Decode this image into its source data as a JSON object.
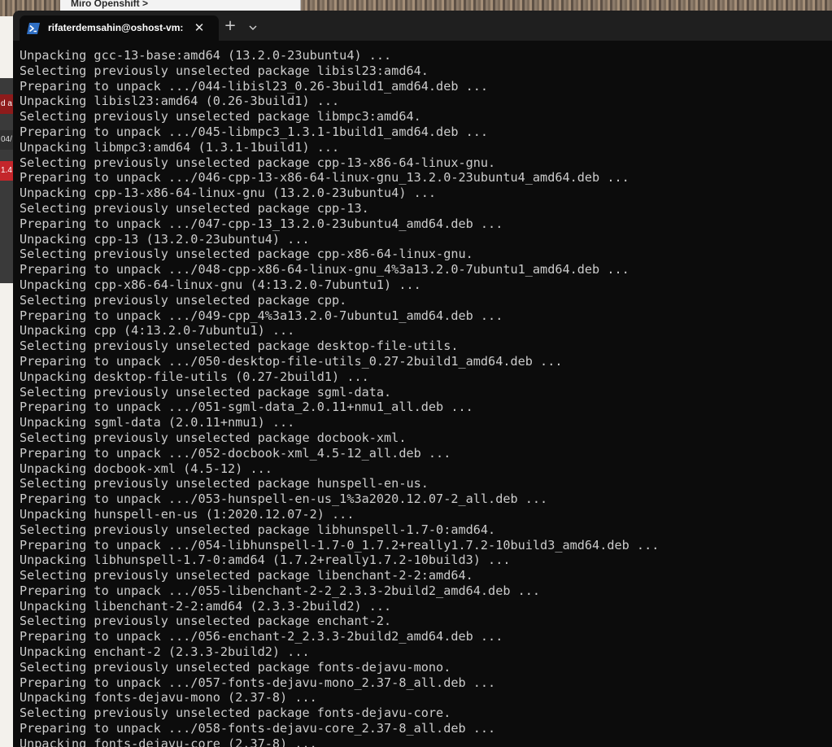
{
  "background": {
    "window_title": "Miro Openshift >",
    "chips": [
      "d a",
      "04/",
      "1.4"
    ]
  },
  "terminal": {
    "tab": {
      "title": "rifaterdemsahin@oshost-vm:",
      "close_icon": "close-icon",
      "shell_icon": "powershell-icon"
    },
    "new_tab_label": "+",
    "colors": {
      "background": "#0c0c0c",
      "text": "#cccccc",
      "titlebar": "#1f1f1f"
    },
    "lines": [
      "Unpacking gcc-13-base:amd64 (13.2.0-23ubuntu4) ...",
      "Selecting previously unselected package libisl23:amd64.",
      "Preparing to unpack .../044-libisl23_0.26-3build1_amd64.deb ...",
      "Unpacking libisl23:amd64 (0.26-3build1) ...",
      "Selecting previously unselected package libmpc3:amd64.",
      "Preparing to unpack .../045-libmpc3_1.3.1-1build1_amd64.deb ...",
      "Unpacking libmpc3:amd64 (1.3.1-1build1) ...",
      "Selecting previously unselected package cpp-13-x86-64-linux-gnu.",
      "Preparing to unpack .../046-cpp-13-x86-64-linux-gnu_13.2.0-23ubuntu4_amd64.deb ...",
      "Unpacking cpp-13-x86-64-linux-gnu (13.2.0-23ubuntu4) ...",
      "Selecting previously unselected package cpp-13.",
      "Preparing to unpack .../047-cpp-13_13.2.0-23ubuntu4_amd64.deb ...",
      "Unpacking cpp-13 (13.2.0-23ubuntu4) ...",
      "Selecting previously unselected package cpp-x86-64-linux-gnu.",
      "Preparing to unpack .../048-cpp-x86-64-linux-gnu_4%3a13.2.0-7ubuntu1_amd64.deb ...",
      "Unpacking cpp-x86-64-linux-gnu (4:13.2.0-7ubuntu1) ...",
      "Selecting previously unselected package cpp.",
      "Preparing to unpack .../049-cpp_4%3a13.2.0-7ubuntu1_amd64.deb ...",
      "Unpacking cpp (4:13.2.0-7ubuntu1) ...",
      "Selecting previously unselected package desktop-file-utils.",
      "Preparing to unpack .../050-desktop-file-utils_0.27-2build1_amd64.deb ...",
      "Unpacking desktop-file-utils (0.27-2build1) ...",
      "Selecting previously unselected package sgml-data.",
      "Preparing to unpack .../051-sgml-data_2.0.11+nmu1_all.deb ...",
      "Unpacking sgml-data (2.0.11+nmu1) ...",
      "Selecting previously unselected package docbook-xml.",
      "Preparing to unpack .../052-docbook-xml_4.5-12_all.deb ...",
      "Unpacking docbook-xml (4.5-12) ...",
      "Selecting previously unselected package hunspell-en-us.",
      "Preparing to unpack .../053-hunspell-en-us_1%3a2020.12.07-2_all.deb ...",
      "Unpacking hunspell-en-us (1:2020.12.07-2) ...",
      "Selecting previously unselected package libhunspell-1.7-0:amd64.",
      "Preparing to unpack .../054-libhunspell-1.7-0_1.7.2+really1.7.2-10build3_amd64.deb ...",
      "Unpacking libhunspell-1.7-0:amd64 (1.7.2+really1.7.2-10build3) ...",
      "Selecting previously unselected package libenchant-2-2:amd64.",
      "Preparing to unpack .../055-libenchant-2-2_2.3.3-2build2_amd64.deb ...",
      "Unpacking libenchant-2-2:amd64 (2.3.3-2build2) ...",
      "Selecting previously unselected package enchant-2.",
      "Preparing to unpack .../056-enchant-2_2.3.3-2build2_amd64.deb ...",
      "Unpacking enchant-2 (2.3.3-2build2) ...",
      "Selecting previously unselected package fonts-dejavu-mono.",
      "Preparing to unpack .../057-fonts-dejavu-mono_2.37-8_all.deb ...",
      "Unpacking fonts-dejavu-mono (2.37-8) ...",
      "Selecting previously unselected package fonts-dejavu-core.",
      "Preparing to unpack .../058-fonts-dejavu-core_2.37-8_all.deb ...",
      "Unpacking fonts-dejavu-core (2.37-8) ..."
    ]
  }
}
